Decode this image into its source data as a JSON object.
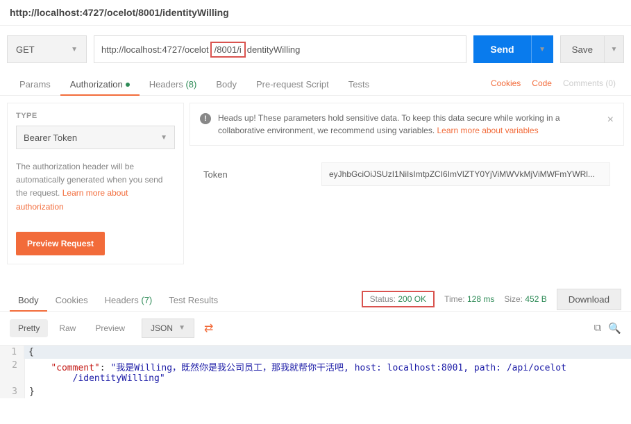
{
  "title": "http://localhost:4727/ocelot/8001/identityWilling",
  "method": "GET",
  "url_pre": "http://localhost:4727/ocelot",
  "url_box": "/8001/i",
  "url_post": "dentityWilling",
  "send": "Send",
  "save": "Save",
  "tabs": {
    "params": "Params",
    "auth": "Authorization",
    "headers": "Headers",
    "headers_count": "(8)",
    "body": "Body",
    "prereq": "Pre-request Script",
    "tests": "Tests",
    "cookies": "Cookies",
    "code": "Code",
    "comments": "Comments (0)"
  },
  "auth": {
    "type_label": "TYPE",
    "type_value": "Bearer Token",
    "help_pre": "The authorization header will be automatically generated when you send the request. ",
    "help_link": "Learn more about authorization",
    "preview": "Preview Request",
    "alert_pre": "Heads up! These parameters hold sensitive data. To keep this data secure while working in a collaborative environment, we recommend using variables. ",
    "alert_link": "Learn more about variables",
    "token_label": "Token",
    "token_value": "eyJhbGciOiJSUzI1NiIsImtpZCI6ImVlZTY0YjViMWVkMjViMWFmYWRl..."
  },
  "resp": {
    "body": "Body",
    "cookies": "Cookies",
    "headers": "Headers",
    "headers_count": "(7)",
    "tests": "Test Results",
    "status_label": "Status:",
    "status_value": "200 OK",
    "time_label": "Time:",
    "time_value": "128 ms",
    "size_label": "Size:",
    "size_value": "452 B",
    "download": "Download"
  },
  "viewer": {
    "pretty": "Pretty",
    "raw": "Raw",
    "preview": "Preview",
    "format": "JSON"
  },
  "json": {
    "key": "\"comment\"",
    "val": "\"我是Willing，既然你是我公司员工，那我就帮你干活吧, host: localhost:8001, path: /api/ocelot\n        /identityWilling\""
  }
}
